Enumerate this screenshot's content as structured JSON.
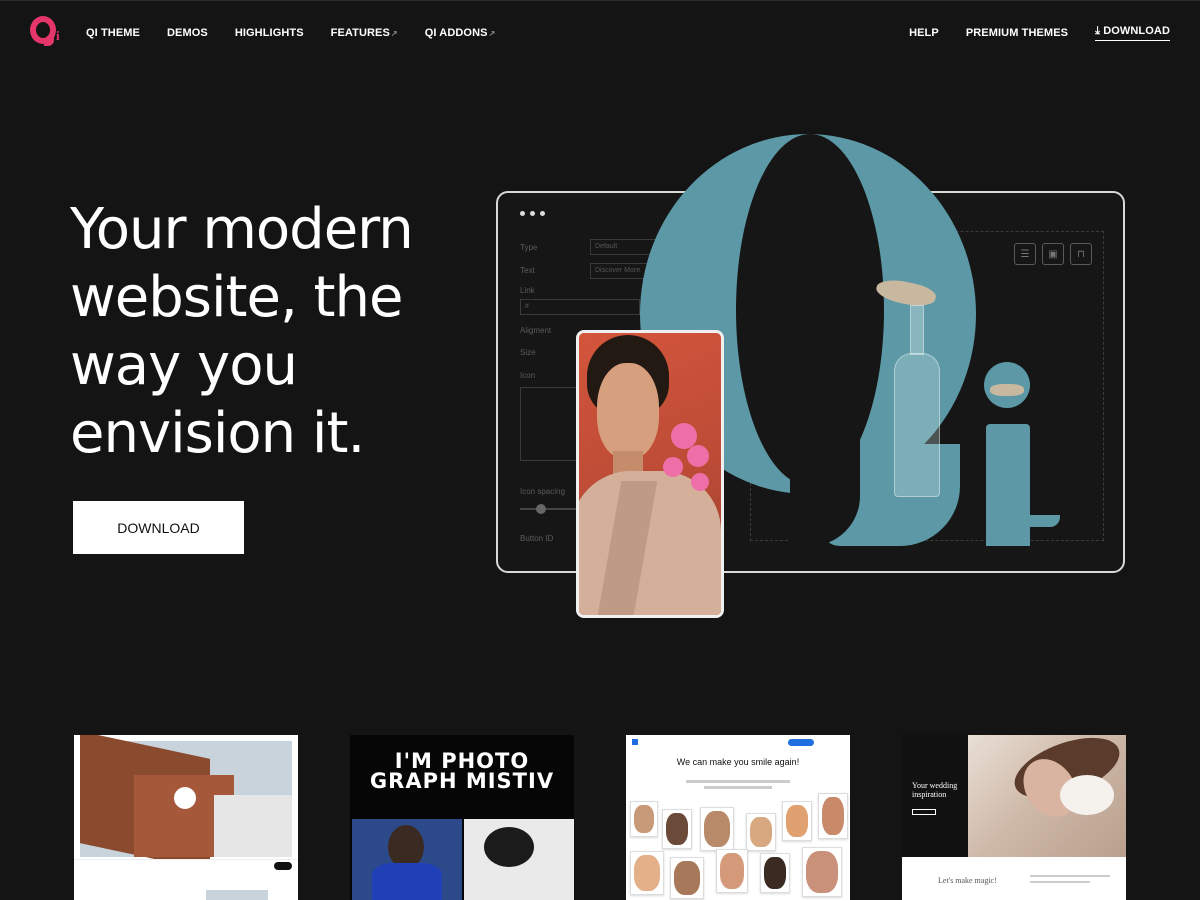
{
  "nav": {
    "logo_text": "Qi",
    "left": [
      {
        "label": "QI THEME"
      },
      {
        "label": "DEMOS"
      },
      {
        "label": "HIGHLIGHTS"
      },
      {
        "label": "FEATURES",
        "arrow": "↗"
      },
      {
        "label": "QI ADDONS",
        "arrow": "↗"
      }
    ],
    "right": {
      "help": "HELP",
      "premium": "PREMIUM THEMES",
      "download": "DOWNLOAD",
      "download_icon": "download-icon"
    }
  },
  "hero": {
    "title": "Your modern website, the way you envision it.",
    "button": "DOWNLOAD"
  },
  "mock": {
    "fields": {
      "type_label": "Type",
      "type_value": "Default",
      "text_label": "Text",
      "text_value": "Discover More",
      "link_label": "Link",
      "link_value": "#",
      "alignment_label": "Aligment",
      "size_label": "Size",
      "icon_label": "Icon",
      "icon_spacing_label": "Icon spacing",
      "button_id_label": "Button ID"
    },
    "toolbar_icons": [
      "sliders-icon",
      "save-icon",
      "inbox-icon"
    ]
  },
  "thumbnails": [
    {
      "name": "architecture-demo",
      "badge": "Qi"
    },
    {
      "name": "photography-demo",
      "text": "I'M PHOTO GRAPH MISTIV"
    },
    {
      "name": "dentist-demo",
      "brand": "Dentist",
      "headline": "We can make you smile again!"
    },
    {
      "name": "wedding-demo",
      "headline": "Your wedding inspiration",
      "tagline": "Let's make magic!"
    }
  ],
  "colors": {
    "background": "#141414",
    "brand_pink": "#e5366b",
    "teal": "#5c98a6",
    "button_bg": "#ffffff"
  }
}
